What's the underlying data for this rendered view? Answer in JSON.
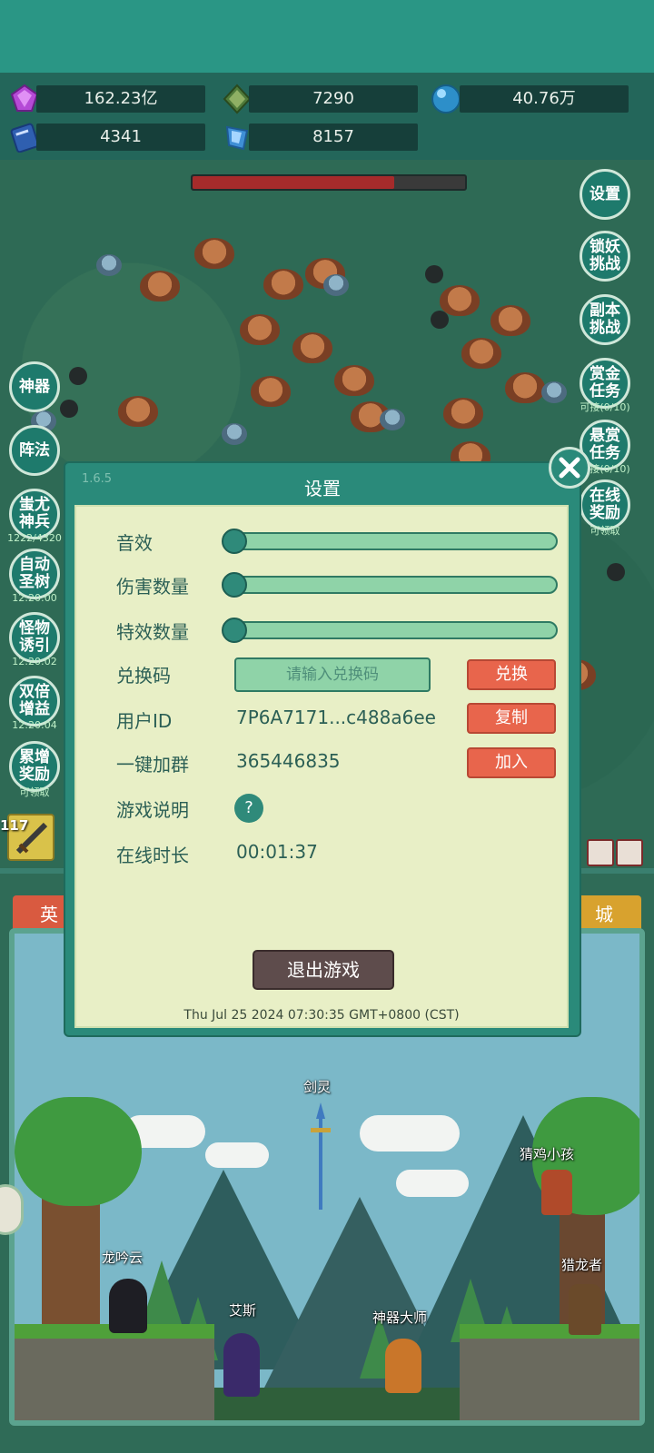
{
  "resources": [
    {
      "icon": "purple-gem-icon",
      "value": "162.23亿"
    },
    {
      "icon": "green-gem-icon",
      "value": "7290"
    },
    {
      "icon": "blue-orb-icon",
      "value": "40.76万"
    },
    {
      "icon": "blue-book-icon",
      "value": "4341"
    },
    {
      "icon": "blue-crystal-icon",
      "value": "8157"
    }
  ],
  "boss_hp_fraction": 0.74,
  "right_buttons": [
    {
      "label": "设置"
    },
    {
      "label": "锁妖挑战"
    },
    {
      "label": "副本挑战"
    },
    {
      "label": "赏金任务",
      "sub": "可接(0/10)"
    },
    {
      "label": "悬赏任务",
      "sub": "可接(0/10)"
    },
    {
      "label": "在线奖励",
      "sub": "可领取"
    }
  ],
  "left_buttons": [
    {
      "label": "神器"
    },
    {
      "label": "阵法"
    },
    {
      "label": "蚩尤神兵",
      "sub": "1222/4320"
    },
    {
      "label": "自动圣树",
      "sub": "12:20:00"
    },
    {
      "label": "怪物诱引",
      "sub": "12:20:02"
    },
    {
      "label": "双倍增益",
      "sub": "12:20:04"
    },
    {
      "label": "累增奖励",
      "sub": "可领取"
    }
  ],
  "skill_slot": {
    "level": "117"
  },
  "bottom_tabs": {
    "left": "英",
    "right": "城"
  },
  "dialog": {
    "version": "1.6.5",
    "title": "设置",
    "sound_label": "音效",
    "damage_label": "伤害数量",
    "effects_label": "特效数量",
    "sound_level": 0,
    "damage_level": 0,
    "effects_level": 0,
    "redeem_label": "兑换码",
    "redeem_placeholder": "请输入兑换码",
    "redeem_button": "兑换",
    "userid_label": "用户ID",
    "userid_value": "7P6A7171...c488a6ee",
    "copy_button": "复制",
    "group_label": "一键加群",
    "group_value": "365446835",
    "join_button": "加入",
    "help_label": "游戏说明",
    "help_icon": "?",
    "online_label": "在线时长",
    "online_value": "00:01:37",
    "exit_button": "退出游戏",
    "timestamp": "Thu Jul 25 2024 07:30:35 GMT+0800 (CST)"
  },
  "npcs": [
    {
      "name": "剑灵"
    },
    {
      "name": "猜鸡小孩"
    },
    {
      "name": "龙吟云"
    },
    {
      "name": "猎龙者"
    },
    {
      "name": "艾斯"
    },
    {
      "name": "神器大师"
    }
  ],
  "colors": {
    "accent": "#2a8a7a",
    "danger": "#e8654c",
    "panel": "#e8efc6"
  }
}
